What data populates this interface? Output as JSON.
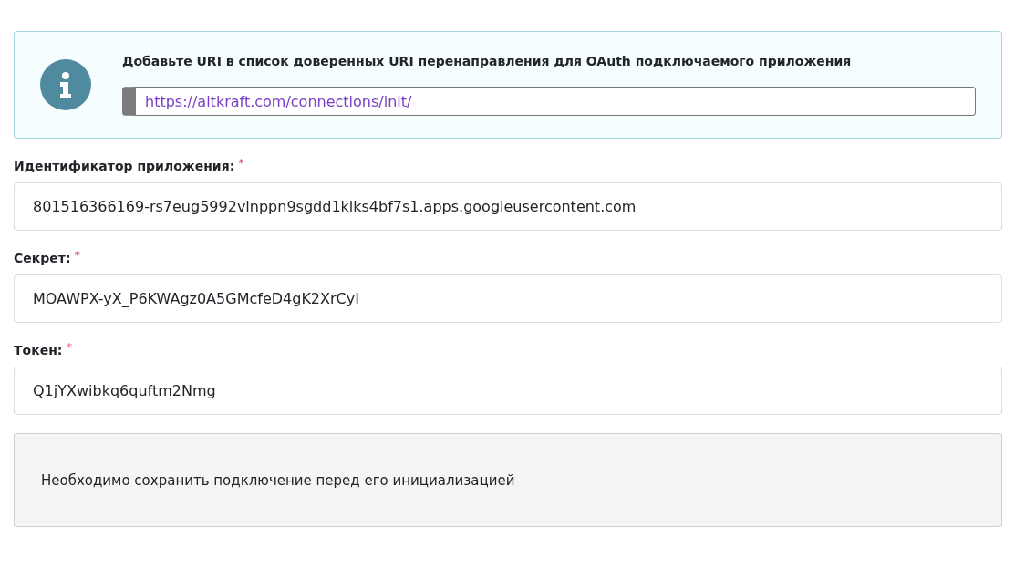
{
  "info_banner": {
    "message": "Добавьте URI в список доверенных URI перенаправления для OAuth подключаемого приложения",
    "uri": "https://altkraft.com/connections/init/"
  },
  "fields": [
    {
      "label": "Идентификатор приложения:",
      "required_mark": "*",
      "value": "801516366169-rs7eug5992vlnppn9sgdd1klks4bf7s1.apps.googleusercontent.com"
    },
    {
      "label": "Секрет:",
      "required_mark": "*",
      "value": "MOAWPX-yX_P6KWAgz0A5GMcfeD4gK2XrCyI"
    },
    {
      "label": "Токен:",
      "required_mark": "*",
      "value": "Q1jYXwibkq6quftm2Nmg"
    }
  ],
  "notice": {
    "message": "Необходимо сохранить подключение перед его инициализацией"
  }
}
